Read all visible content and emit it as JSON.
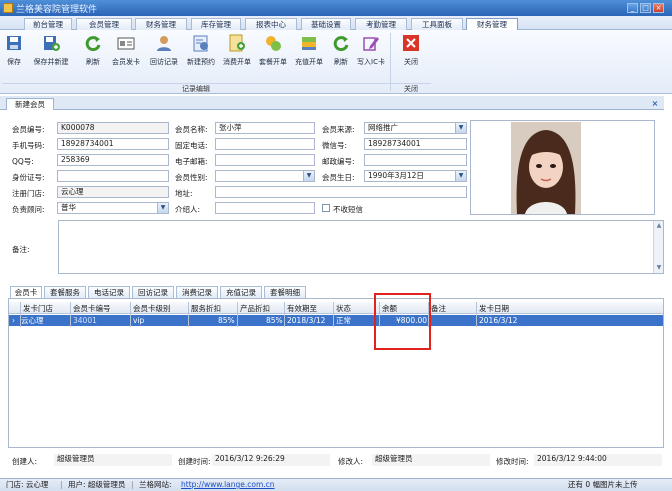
{
  "window": {
    "title": "兰格美容院管理软件"
  },
  "menu": {
    "tabs": [
      "前台管理",
      "会员管理",
      "财务管理",
      "库存管理",
      "报表中心",
      "基础设置",
      "考勤管理",
      "工具面板",
      "财务管理"
    ]
  },
  "ribbon": {
    "buttons": [
      "保存",
      "保存并新建",
      "刷新",
      "会员发卡",
      "回访记录",
      "新建预约",
      "消费开单",
      "套餐开单",
      "充值开单",
      "刷新",
      "写入IC卡",
      "关闭"
    ],
    "group_record": "记录编辑",
    "group_close": "关闭"
  },
  "doc": {
    "tab": "新建会员"
  },
  "form": {
    "member_no_label": "会员编号:",
    "member_no": "K000078",
    "member_name_label": "会员名称:",
    "member_name": "张小萍",
    "source_label": "会员来源:",
    "source": "网络推广",
    "mobile_label": "手机号码:",
    "mobile": "18928734001",
    "tel_label": "固定电话:",
    "tel": "",
    "wechat_label": "微信号:",
    "wechat": "18928734001",
    "qq_label": "QQ号:",
    "qq": "258369",
    "email_label": "电子邮箱:",
    "email": "",
    "zip_label": "邮政编号:",
    "zip": "",
    "id_label": "身份证号:",
    "id": "",
    "gender_label": "会员性别:",
    "gender": "",
    "birthday_label": "会员生日:",
    "birthday": "1990年3月12日",
    "store_label": "注册门店:",
    "store": "云心理",
    "address_label": "地址:",
    "address": "",
    "advisor_label": "负责顾问:",
    "advisor": "普华",
    "referrer_label": "介绍人:",
    "referrer": "",
    "no_sms_label": "不收短信",
    "remark_label": "备注:"
  },
  "subtabs": [
    "会员卡",
    "套餐服务",
    "电话记录",
    "回访记录",
    "消费记录",
    "充值记录",
    "套餐明细"
  ],
  "grid": {
    "headers": [
      "发卡门店",
      "会员卡编号",
      "会员卡级别",
      "服务折扣",
      "产品折扣",
      "有效期至",
      "状态",
      "余额",
      "备注",
      "发卡日期"
    ],
    "rows": [
      [
        "云心理",
        "34001",
        "vip",
        "85%",
        "85%",
        "2018/3/12",
        "正常",
        "¥800.00",
        "",
        "2016/3/12"
      ]
    ]
  },
  "info": {
    "creator_label": "创建人:",
    "creator": "超级管理员",
    "created_label": "创建时间:",
    "created": "2016/3/12 9:26:29",
    "modifier_label": "修改人:",
    "modifier": "超级管理员",
    "modified_label": "修改时间:",
    "modified": "2016/3/12 9:44:00"
  },
  "status": {
    "store": "门店: 云心理",
    "user": "用户: 超级管理员",
    "site_label": "兰格网站:",
    "site_url": "http://www.lange.com.cn",
    "upload": "还有 0 幅图片未上传"
  },
  "colors": {
    "accent": "#2a64b7",
    "selected_row": "#3a73c9",
    "highlight": "#e0231f"
  }
}
